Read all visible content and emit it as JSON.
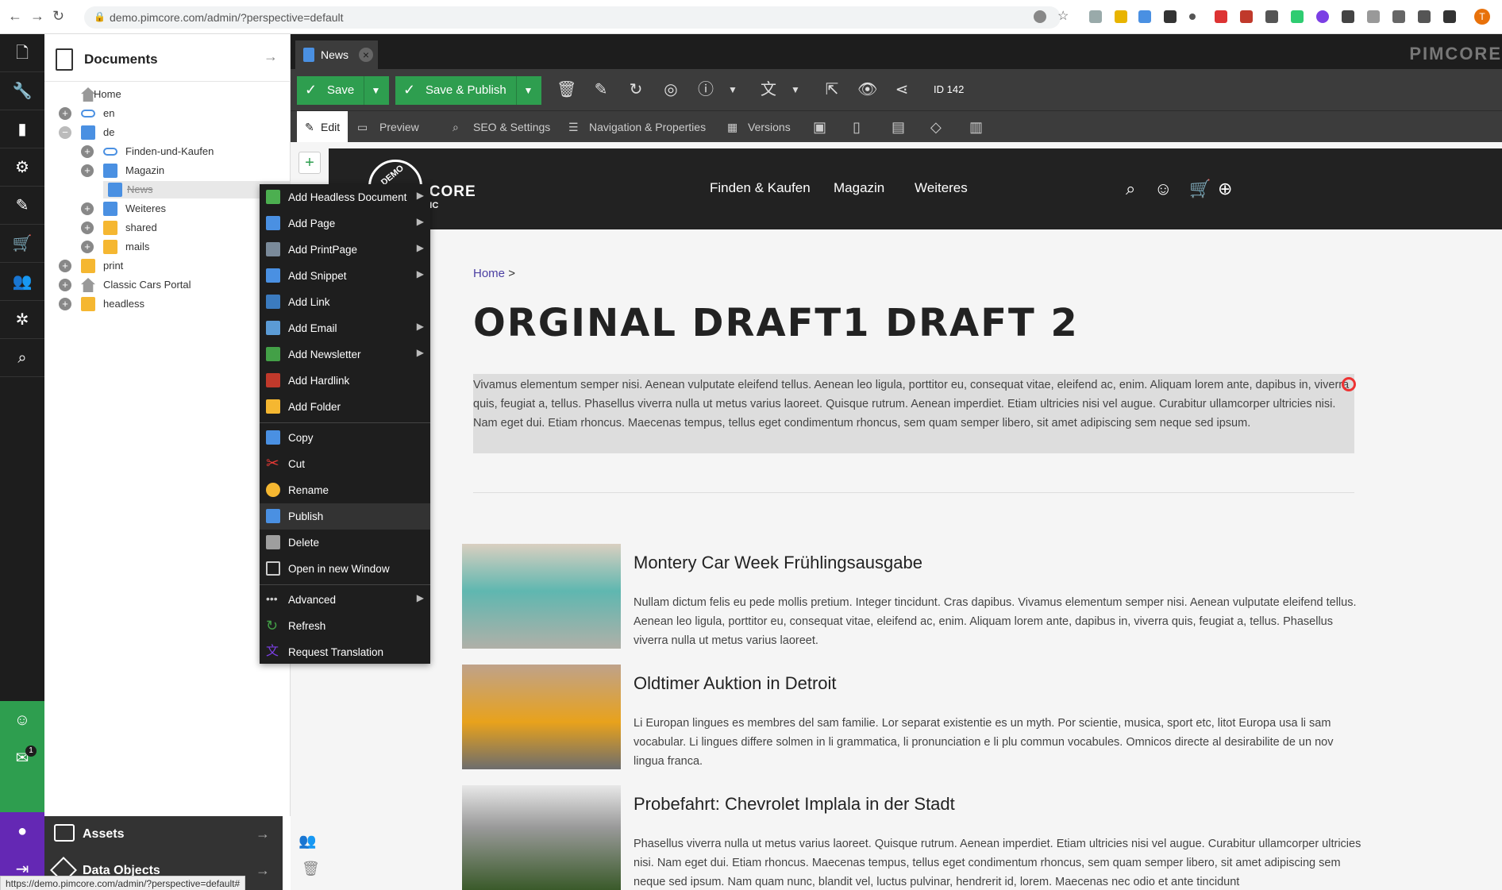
{
  "browser": {
    "url": "demo.pimcore.com/admin/?perspective=default",
    "profile_initial": "T",
    "status_url": "https://demo.pimcore.com/admin/?perspective=default#"
  },
  "rail": {
    "icons": [
      "document-icon",
      "wrench-icon",
      "chart-icon",
      "gear-icon",
      "feather-icon",
      "cart-icon",
      "users-icon",
      "network-icon",
      "search-icon"
    ],
    "bottom_badge": "1"
  },
  "tree": {
    "title": "Documents",
    "items": [
      {
        "label": "Home",
        "icon": "home-icon",
        "level": 0
      },
      {
        "label": "en",
        "icon": "link-icon",
        "level": 0
      },
      {
        "label": "de",
        "icon": "document-icon",
        "level": 0
      },
      {
        "label": "Finden-und-Kaufen",
        "icon": "link-icon",
        "level": 1
      },
      {
        "label": "Magazin",
        "icon": "document-icon",
        "level": 1
      },
      {
        "label": "News",
        "icon": "document-icon",
        "level": 2
      },
      {
        "label": "Weiteres",
        "icon": "document-icon",
        "level": 1
      },
      {
        "label": "shared",
        "icon": "folder-icon",
        "level": 1
      },
      {
        "label": "mails",
        "icon": "folder-icon",
        "level": 1
      },
      {
        "label": "print",
        "icon": "folder-icon",
        "level": 0
      },
      {
        "label": "Classic Cars Portal",
        "icon": "home-icon",
        "level": 0
      },
      {
        "label": "headless",
        "icon": "folder-icon",
        "level": 0
      }
    ]
  },
  "accordion": {
    "assets": "Assets",
    "data_objects": "Data Objects"
  },
  "tab": {
    "label": "News"
  },
  "brand": "PIMCORE",
  "toolbar": {
    "save": "Save",
    "save_publish": "Save & Publish",
    "id": "ID 142"
  },
  "subtabs": [
    "Edit",
    "Preview",
    "SEO & Settings",
    "Navigation & Properties",
    "Versions"
  ],
  "site": {
    "logo_demo": "DEMO",
    "logo_name": "PIMCORE",
    "logo_sub": "CLASSIC CARS",
    "nav": [
      "Finden & Kaufen",
      "Magazin",
      "Weiteres"
    ],
    "breadcrumb_home": "Home",
    "breadcrumb_sep": ">",
    "title": "ORGINAL DRAFT1 DRAFT 2",
    "intro": "Vivamus elementum semper nisi. Aenean vulputate eleifend tellus. Aenean leo ligula, porttitor eu, consequat vitae, eleifend ac, enim. Aliquam lorem ante, dapibus in, viverra quis, feugiat a, tellus. Phasellus viverra nulla ut metus varius laoreet. Quisque rutrum. Aenean imperdiet. Etiam ultricies nisi vel augue. Curabitur ullamcorper ultricies nisi. Nam eget dui. Etiam rhoncus. Maecenas tempus, tellus eget condimentum rhoncus, sem quam semper libero, sit amet adipiscing sem neque sed ipsum."
  },
  "articles": [
    {
      "title": "Montery Car Week Frühlingsausgabe",
      "text": "Nullam dictum felis eu pede mollis pretium. Integer tincidunt. Cras dapibus. Vivamus elementum semper nisi. Aenean vulputate eleifend tellus. Aenean leo ligula, porttitor eu, consequat vitae, eleifend ac, enim. Aliquam lorem ante, dapibus in, viverra quis, feugiat a, tellus. Phasellus viverra nulla ut metus varius laoreet."
    },
    {
      "title": "Oldtimer Auktion in Detroit",
      "text": "Li Europan lingues es membres del sam familie. Lor separat existentie es un myth. Por scientie, musica, sport etc, litot Europa usa li sam vocabular. Li lingues differe solmen in li grammatica, li pronunciation e li plu commun vocabules. Omnicos directe al desirabilite de un nov lingua franca."
    },
    {
      "title": "Probefahrt: Chevrolet Implala in der Stadt",
      "text": "Phasellus viverra nulla ut metus varius laoreet. Quisque rutrum. Aenean imperdiet. Etiam ultricies nisi vel augue. Curabitur ullamcorper ultricies nisi. Nam eget dui. Etiam rhoncus. Maecenas tempus, tellus eget condimentum rhoncus, sem quam semper libero, sit amet adipiscing sem neque sed ipsum. Nam quam nunc, blandit vel, luctus pulvinar, hendrerit id, lorem. Maecenas nec odio et ante tincidunt"
    }
  ],
  "context_menu": {
    "items": [
      {
        "label": "Add Headless Document",
        "submenu": true
      },
      {
        "label": "Add Page",
        "submenu": true
      },
      {
        "label": "Add PrintPage",
        "submenu": true
      },
      {
        "label": "Add Snippet",
        "submenu": true
      },
      {
        "label": "Add Link",
        "submenu": false
      },
      {
        "label": "Add Email",
        "submenu": true
      },
      {
        "label": "Add Newsletter",
        "submenu": true
      },
      {
        "label": "Add Hardlink",
        "submenu": false
      },
      {
        "label": "Add Folder",
        "submenu": false
      },
      {
        "label": "Copy",
        "submenu": false
      },
      {
        "label": "Cut",
        "submenu": false
      },
      {
        "label": "Rename",
        "submenu": false
      },
      {
        "label": "Publish",
        "submenu": false
      },
      {
        "label": "Delete",
        "submenu": false
      },
      {
        "label": "Open in new Window",
        "submenu": false
      },
      {
        "label": "Advanced",
        "submenu": true
      },
      {
        "label": "Refresh",
        "submenu": false
      },
      {
        "label": "Request Translation",
        "submenu": false
      }
    ]
  },
  "colors": {
    "accent_green": "#2e9e4f",
    "dark": "#1d1d1d",
    "toolbar": "#3c3c3c",
    "purple": "#6428b4"
  }
}
